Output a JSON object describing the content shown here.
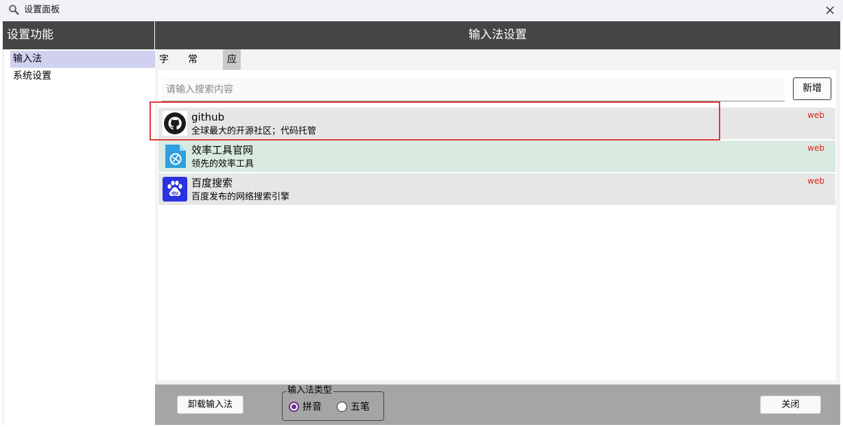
{
  "window": {
    "title": "设置面板"
  },
  "sidebar": {
    "header": "设置功能",
    "items": [
      {
        "label": "输入法",
        "selected": true
      },
      {
        "label": "系统设置",
        "selected": false
      }
    ]
  },
  "main": {
    "header": "输入法设置",
    "tabs": [
      {
        "label": "字库",
        "active": false
      },
      {
        "label": "常用词",
        "active": false
      },
      {
        "label": "应用",
        "active": true
      }
    ],
    "search": {
      "placeholder": "请输入搜索内容",
      "value": ""
    },
    "add_button": "新增",
    "apps": [
      {
        "name": "github",
        "desc": "全球最大的开源社区；代码托管",
        "tag": "web",
        "icon": "github-icon",
        "bg": "#e6e6e6"
      },
      {
        "name": "效率工具官网",
        "desc": "领先的效率工具",
        "tag": "web",
        "icon": "efficiency-tool-icon",
        "bg": "#d9ebe0"
      },
      {
        "name": "百度搜索",
        "desc": "百度发布的网络搜索引擎",
        "tag": "web",
        "icon": "baidu-icon",
        "bg": "#e6e6e6"
      }
    ]
  },
  "footer": {
    "uninstall_button": "卸载输入法",
    "ime_type": {
      "title": "输入法类型",
      "options": [
        {
          "label": "拼音",
          "checked": true
        },
        {
          "label": "五笔",
          "checked": false
        }
      ]
    },
    "close_button": "关闭"
  },
  "colors": {
    "header_bg": "#454545",
    "selected_nav": "#cfd1ef",
    "tag_red": "#e02020",
    "highlight_red": "#e0393a",
    "radio_purple": "#6d2c8c"
  }
}
